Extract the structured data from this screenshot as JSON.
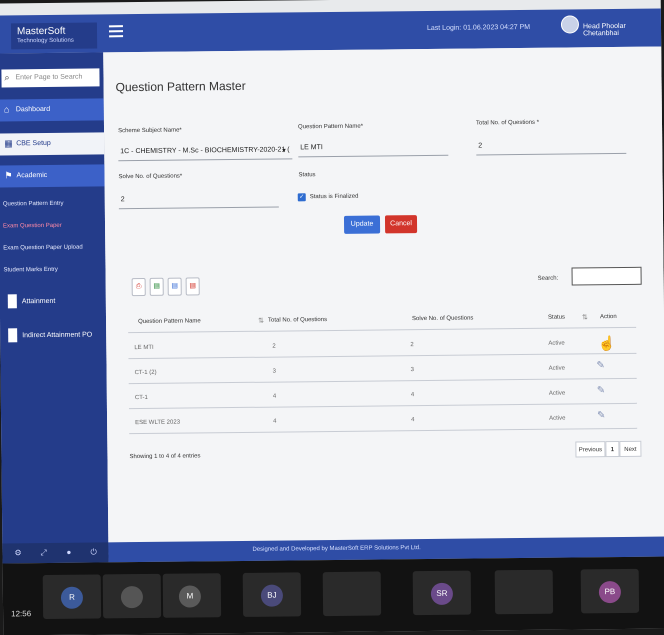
{
  "header": {
    "brand_name": "MasterSoft",
    "brand_tagline": "Technology Solutions",
    "last_login": "Last Login: 01.06.2023 04:27 PM",
    "user_name": "Head Phoolar Chetanbhai"
  },
  "sidebar": {
    "search_placeholder": "Enter Page to Search",
    "items": [
      {
        "label": "Dashboard"
      },
      {
        "label": "CBE Setup"
      },
      {
        "label": "Academic"
      }
    ],
    "sub_items": [
      {
        "label": "Question Pattern Entry"
      },
      {
        "label": "Exam Question Paper"
      },
      {
        "label": "Exam Question Paper Upload"
      },
      {
        "label": "Student Marks Entry"
      }
    ],
    "bottom_items": [
      {
        "label": "Attainment"
      },
      {
        "label": "Indirect Attainment PO"
      }
    ]
  },
  "page": {
    "title": "Question Pattern Master",
    "form": {
      "scheme_label": "Scheme Subject Name*",
      "scheme_value": "1C - CHEMISTRY - M.Sc - BIOCHEMISTRY-2020-21 (",
      "pattern_label": "Question Pattern Name*",
      "pattern_value": "LE MTI",
      "total_q_label": "Total No. of Questions *",
      "total_q_value": "2",
      "solve_q_label": "Solve No. of Questions*",
      "solve_q_value": "2",
      "status_label": "Status",
      "status_checkbox_label": "Status is Finalized",
      "update_label": "Update",
      "cancel_label": "Cancel"
    },
    "search_label": "Search:",
    "table": {
      "columns": [
        "Question Pattern Name",
        "Total No. of Questions",
        "Solve No. of Questions",
        "Status",
        "Action"
      ],
      "rows": [
        {
          "name": "LE MTI",
          "total": "2",
          "solve": "2",
          "status": "Active"
        },
        {
          "name": "CT-1 (2)",
          "total": "3",
          "solve": "3",
          "status": "Active"
        },
        {
          "name": "CT-1",
          "total": "4",
          "solve": "4",
          "status": "Active"
        },
        {
          "name": "ESE WLTE 2023",
          "total": "4",
          "solve": "4",
          "status": "Active"
        }
      ]
    },
    "showing": "Showing 1 to 4 of 4 entries",
    "pagination": {
      "prev": "Previous",
      "current": "1",
      "next": "Next"
    }
  },
  "footer": "Designed and Developed by MasterSoft ERP Solutions Pvt Ltd.",
  "meeting": {
    "time": "12:56",
    "participants": [
      "R",
      "",
      "M",
      "BJ",
      "",
      "SR",
      "",
      "PB"
    ]
  }
}
